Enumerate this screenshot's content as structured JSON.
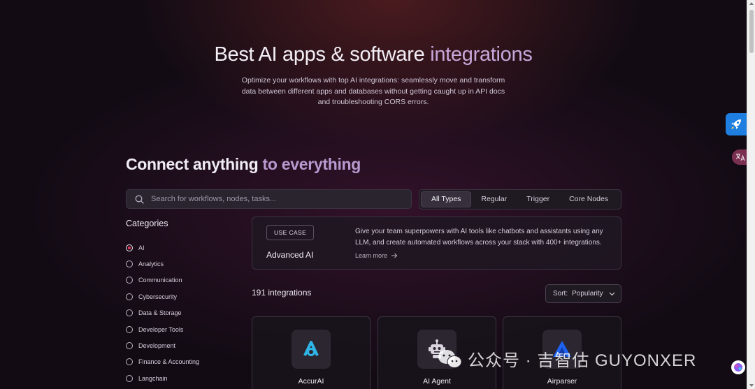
{
  "hero": {
    "title_main": "Best AI apps & software ",
    "title_accent": "integrations",
    "subtitle": "Optimize your workflows with top AI integrations: seamlessly move and transform data between different apps and databases without getting caught up in API docs and troubleshooting CORS errors."
  },
  "section": {
    "title_main": "Connect anything ",
    "title_accent": "to everything"
  },
  "search": {
    "placeholder": "Search for workflows, nodes, tasks...",
    "value": ""
  },
  "type_tabs": [
    {
      "label": "All Types",
      "active": true
    },
    {
      "label": "Regular",
      "active": false
    },
    {
      "label": "Trigger",
      "active": false
    },
    {
      "label": "Core Nodes",
      "active": false
    }
  ],
  "categories": {
    "title": "Categories",
    "selected": "AI",
    "items": [
      "AI",
      "Analytics",
      "Communication",
      "Cybersecurity",
      "Data & Storage",
      "Developer Tools",
      "Development",
      "Finance & Accounting",
      "Langchain"
    ]
  },
  "use_case": {
    "badge": "USE CASE",
    "title": "Advanced AI",
    "description": "Give your team superpowers with AI tools like chatbots and assistants using any LLM, and create automated workflows across your stack with 400+ integrations.",
    "link": "Learn more"
  },
  "results": {
    "count": "191 integrations",
    "sort_label": "Sort:",
    "sort_value": "Popularity"
  },
  "integrations": [
    {
      "name": "AccurAI",
      "icon": "accurai-logo-icon"
    },
    {
      "name": "AI Agent",
      "icon": "robot-icon"
    },
    {
      "name": "Airparser",
      "icon": "airparser-logo-icon"
    }
  ],
  "watermark": {
    "text": "公众号 · 吉智估 GUYONXER"
  },
  "colors": {
    "background": "#120b14",
    "accent": "#c7a6da",
    "radio_selected": "#e63e5c",
    "rocket_widget": "#1e7fe0"
  }
}
